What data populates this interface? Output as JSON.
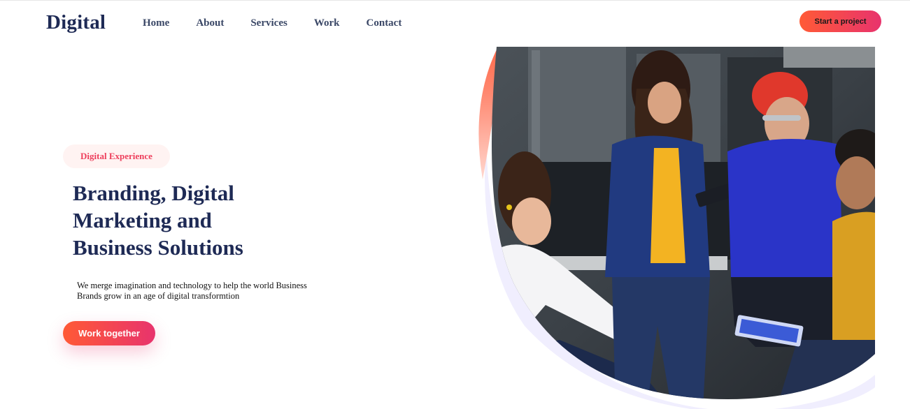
{
  "header": {
    "logo": "Digital",
    "nav": [
      "Home",
      "About",
      "Services",
      "Work",
      "Contact"
    ],
    "cta_label": "Start a project"
  },
  "hero": {
    "badge": "Digital Experience",
    "headline_lines": [
      "Branding, Digital",
      "Marketing and",
      "Business Solutions"
    ],
    "description_lines": [
      "We merge imagination and technology to help the world Business",
      "Brands grow in an age of digital transformtion"
    ],
    "button_label": "Work together"
  },
  "colors": {
    "brand_navy": "#1e2a55",
    "gradient_start": "#ff5a36",
    "gradient_end": "#e8336d",
    "badge_text": "#ee3f5c",
    "badge_bg": "#fff3f2",
    "accent_ring": "#f0eefe"
  },
  "image": {
    "subject": "team-of-four-colleagues-in-office"
  }
}
